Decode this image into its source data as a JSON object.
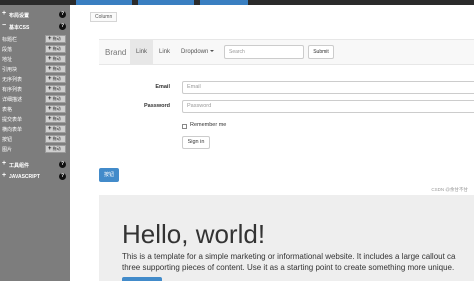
{
  "colors": {
    "sidebar_bg": "#7d7d7d",
    "accent_blue": "#428bca",
    "jumbotron_bg": "#eeeeee",
    "navbar_bg": "#f8f8f8"
  },
  "sidebar": {
    "groups_top": [
      {
        "label": "布局设置",
        "icon": "question-icon"
      },
      {
        "label": "基本CSS",
        "icon": "question-icon"
      }
    ],
    "items": [
      {
        "label": "标题栏",
        "add": "拖动"
      },
      {
        "label": "段落",
        "add": "拖动"
      },
      {
        "label": "地址",
        "add": "拖动"
      },
      {
        "label": "引用块",
        "add": "拖动"
      },
      {
        "label": "无序列表",
        "add": "拖动"
      },
      {
        "label": "有序列表",
        "add": "拖动"
      },
      {
        "label": "详细描述",
        "add": "拖动"
      },
      {
        "label": "表格",
        "add": "拖动"
      },
      {
        "label": "提交表单",
        "add": "拖动"
      },
      {
        "label": "横向表单",
        "add": "拖动"
      },
      {
        "label": "按钮",
        "add": "拖动"
      },
      {
        "label": "图片",
        "add": "拖动"
      }
    ],
    "groups_bottom": [
      {
        "label": "工具组件",
        "icon": "question-icon"
      },
      {
        "label": "JAVASCRIPT",
        "icon": "question-icon"
      }
    ]
  },
  "main": {
    "column_tag": "Column",
    "navbar": {
      "brand": "Brand",
      "links": [
        "Link",
        "Link"
      ],
      "dropdown": "Dropdown",
      "search_placeholder": "Search",
      "submit": "Submit"
    },
    "form": {
      "email_label": "Email",
      "email_placeholder": "Email",
      "password_label": "Password",
      "password_placeholder": "Password",
      "remember": "Remember me",
      "signin": "Sign in"
    },
    "blue_button": "按钮",
    "watermark": "CSDN @余甘不甘",
    "jumbotron": {
      "title": "Hello, world!",
      "line1": "This is a template for a simple marketing or informational website. It includes a large callout ca",
      "line2": "three supporting pieces of content. Use it as a starting point to create something more unique."
    }
  }
}
